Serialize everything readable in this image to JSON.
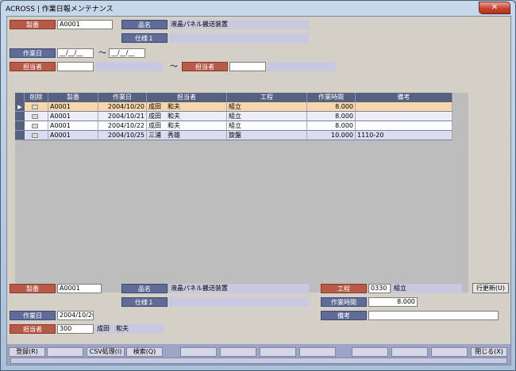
{
  "window": {
    "title": "ACROSS | 作業日報メンテナンス",
    "close_icon": "close-icon"
  },
  "filter": {
    "seiban_label": "製番",
    "seiban_value": "A0001",
    "hinmei_label": "品名",
    "hinmei_value": "液晶パネル搬送装置",
    "shiyou_label": "仕様１",
    "shiyou_value": "",
    "sagyoubi_label": "作業日",
    "date_from": "__/__/__",
    "date_to": "__/__/__",
    "tilde": "～",
    "tantou_label": "担当者",
    "tantou_from": "",
    "tantou_from_name": "",
    "tantou_label2": "担当者",
    "tantou_to": "",
    "tantou_to_name": ""
  },
  "grid": {
    "columns": [
      "削除",
      "製番",
      "作業日",
      "担当者",
      "工程",
      "作業時間",
      "備考"
    ],
    "rows": [
      {
        "seiban": "A0001",
        "date": "2004/10/20",
        "tantou": "成田　和夫",
        "koutei": "組立",
        "hours": "8.000",
        "bikou": "",
        "current": true
      },
      {
        "seiban": "A0001",
        "date": "2004/10/21",
        "tantou": "成田　和夫",
        "koutei": "組立",
        "hours": "8.000",
        "bikou": "",
        "current": false
      },
      {
        "seiban": "A0001",
        "date": "2004/10/22",
        "tantou": "成田　和夫",
        "koutei": "組立",
        "hours": "8.000",
        "bikou": "",
        "current": false
      },
      {
        "seiban": "A0001",
        "date": "2004/10/25",
        "tantou": "三浦　秀雄",
        "koutei": "旋盤",
        "hours": "10.000",
        "bikou": "1110-20",
        "current": false
      }
    ],
    "current_marker": "▶"
  },
  "detail": {
    "seiban_label": "製番",
    "seiban_value": "A0001",
    "hinmei_label": "品名",
    "hinmei_value": "液晶パネル搬送装置",
    "shiyou_label": "仕様１",
    "shiyou_value": "",
    "koutei_label": "工程",
    "koutei_code": "0330",
    "koutei_name": "組立",
    "jikan_label": "作業時間",
    "jikan_value": "8.000",
    "sagyoubi_label": "作業日",
    "sagyoubi_value": "2004/10/20",
    "bikou_label": "備考",
    "bikou_value": "",
    "tantou_label": "担当者",
    "tantou_code": "300",
    "tantou_name": "成田　和夫",
    "update_button": "行更新(U)"
  },
  "toolbar": {
    "register": "登録(R)",
    "blank1": "",
    "csv": "CSV処理(I)",
    "search": "検索(Q)",
    "blank2": "",
    "blank3": "",
    "blank4": "",
    "blank5": "",
    "blank6": "",
    "blank7": "",
    "blank8": "",
    "close": "閉じる(X)"
  }
}
